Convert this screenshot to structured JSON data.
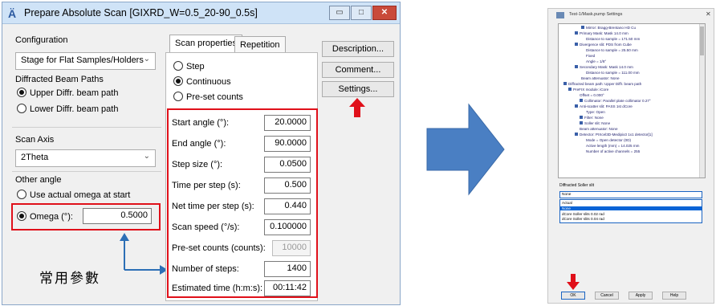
{
  "dialog": {
    "title": "Prepare Absolute Scan [GIXRD_W=0.5_20-90_0.5s]",
    "window_buttons": {
      "minimize": "▭",
      "maximize": "□",
      "close": "✕"
    },
    "configuration": {
      "label": "Configuration",
      "selected": "Stage for Flat Samples/Holders"
    },
    "diffracted_beam": {
      "label": "Diffracted Beam Paths",
      "options": [
        {
          "label": "Upper Diffr. beam path",
          "checked": true
        },
        {
          "label": "Lower Diffr. beam path",
          "checked": false
        }
      ]
    },
    "scan_axis": {
      "label": "Scan Axis",
      "selected": "2Theta"
    },
    "other_angle": {
      "label": "Other angle",
      "use_actual": "Use actual omega at start",
      "omega_label": "Omega (°):",
      "omega_value": "0.5000"
    },
    "tabs": [
      {
        "label": "Scan properties",
        "active": true
      },
      {
        "label": "Repetition",
        "active": false
      }
    ],
    "scan_mode": [
      {
        "label": "Step",
        "checked": false
      },
      {
        "label": "Continuous",
        "checked": true
      },
      {
        "label": "Pre-set counts",
        "checked": false
      }
    ],
    "params": [
      {
        "label": "Start angle (°):",
        "value": "20.0000",
        "readonly": false
      },
      {
        "label": "End angle (°):",
        "value": "90.0000",
        "readonly": false
      },
      {
        "label": "Step size (°):",
        "value": "0.0500",
        "readonly": false
      },
      {
        "label": "Time per step (s):",
        "value": "0.500",
        "readonly": false
      },
      {
        "label": "Net time per step (s):",
        "value": "0.440",
        "readonly": true
      },
      {
        "label": "Scan speed (°/s):",
        "value": "0.100000",
        "readonly": false
      },
      {
        "label": "Pre-set counts (counts):",
        "value": "10000",
        "readonly": true
      },
      {
        "label": "Number of steps:",
        "value": "1400",
        "readonly": false
      },
      {
        "label": "Estimated time (h:m:s):",
        "value": "00:11:42",
        "readonly": false
      }
    ],
    "buttons": {
      "description": "Description...",
      "comment": "Comment...",
      "settings": "Settings..."
    }
  },
  "annotation": {
    "cjk_label": "常用參數",
    "color": "#e0101a",
    "arrow_color": "#2c6fb6"
  },
  "settings_window": {
    "title": "Test-1/Mask.pump Settings",
    "tree": [
      "Mirror: Bragg-Brentano HD Cu",
      "Primary Mask: Mask 14.0 mm",
      "Distance to sample = 171.50 mm",
      "Divergence slit: PDS from Cube",
      "Distance to sample = 25.50 mm",
      "Fixed",
      "Angle = 1/8°",
      "Secondary Mask: Mask 14.0 mm",
      "Distance to sample = 111.00 mm",
      "Beam attenuator: None",
      "Diffracted beam path: Upper Diffr. beam path",
      "PreFIX module: iCore",
      "Offset = 0.000°",
      "Collimator: Parallel plate collimator 0.27°",
      "Anti-scatter slit: PASS 1st dCore",
      "Type: Open",
      "Filter: None",
      "Soller slit: None",
      "Beam attenuator: None",
      "Detector: PIXcel3D-Medipix3 1x1 detector[1]",
      "Mode = Open detector (0D)",
      "Active length (mm) = 14.025 mm",
      "Number of active channels = 255"
    ],
    "soller_label": "Diffracted Soller slit",
    "soller_selected": "None",
    "soller_options": [
      "Actual",
      "None",
      "dCore Soller slits 0.02 rad",
      "dCore Soller slits 0.04 rad"
    ],
    "soller_selected_index": 1,
    "buttons": [
      "OK",
      "Cancel",
      "Apply",
      "Help"
    ]
  }
}
